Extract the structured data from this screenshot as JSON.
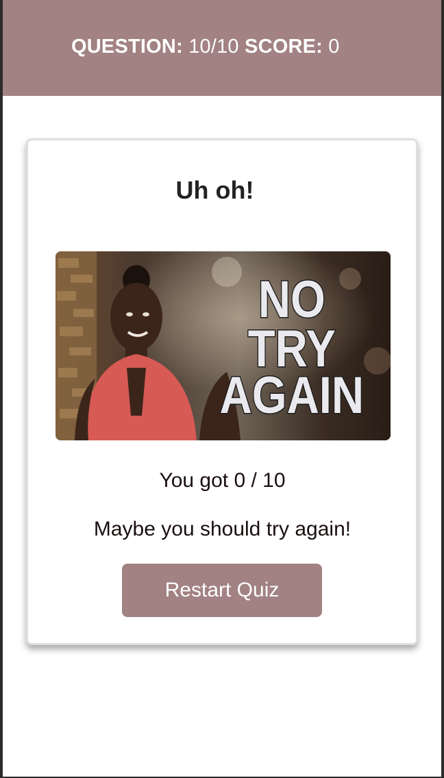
{
  "header": {
    "question_label": "QUESTION:",
    "question_value": "10/10",
    "score_label": "SCORE:",
    "score_value": "0"
  },
  "result": {
    "title": "Uh oh!",
    "gif": {
      "icon": "no-try-again-gif",
      "caption_lines": [
        "NO",
        "TRY",
        "AGAIN"
      ]
    },
    "score_text": "You got 0 / 10",
    "message": "Maybe you should try again!",
    "restart_label": "Restart Quiz"
  },
  "colors": {
    "brand": "#a28282",
    "text_dark": "#232323",
    "text_body": "#1a0f0f"
  }
}
